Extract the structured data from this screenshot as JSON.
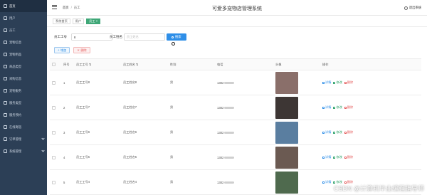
{
  "app": {
    "title": "可爱多宠物店管理系统"
  },
  "header": {
    "breadcrumb": [
      "首页",
      "/",
      "员工"
    ],
    "logout": "退出系统"
  },
  "sidebar": {
    "items": [
      {
        "label": "首页",
        "active": true,
        "caret": false
      },
      {
        "label": "用户",
        "active": false,
        "caret": false
      },
      {
        "label": "员工",
        "active": false,
        "caret": false
      },
      {
        "label": "宠物信息",
        "active": false,
        "caret": false
      },
      {
        "label": "宠物用品",
        "active": false,
        "caret": false
      },
      {
        "label": "商品类型",
        "active": false,
        "caret": false
      },
      {
        "label": "采购信息",
        "active": false,
        "caret": false
      },
      {
        "label": "宠物服务",
        "active": false,
        "caret": false
      },
      {
        "label": "服务类型",
        "active": false,
        "caret": false
      },
      {
        "label": "服务预约",
        "active": false,
        "caret": false
      },
      {
        "label": "在线寄宿",
        "active": false,
        "caret": false
      },
      {
        "label": "订单管理",
        "active": false,
        "caret": true
      },
      {
        "label": "系统管理",
        "active": false,
        "caret": true
      }
    ]
  },
  "tabs": [
    "系统首页",
    "用户",
    "员工 ×"
  ],
  "search": {
    "id_label": "员工工号",
    "id_value": "8",
    "name_label": "员工姓名",
    "name_placeholder": "员工姓名",
    "button": "搜索"
  },
  "actions": {
    "add": "增加",
    "delete": "删除"
  },
  "table": {
    "headers": [
      "序号",
      "员工工号 ⇅",
      "员工姓名 ⇅",
      "性别",
      "电话",
      "头像",
      "操作"
    ],
    "rows": [
      {
        "idx": "1",
        "id": "员工工号8",
        "name": "员工姓名8",
        "sex": "男",
        "phone": "1382",
        "avatar_color": "#8a6f6a"
      },
      {
        "idx": "2",
        "id": "员工工号7",
        "name": "员工姓名7",
        "sex": "男",
        "phone": "1382",
        "avatar_color": "#3d3634"
      },
      {
        "idx": "3",
        "id": "员工工号6",
        "name": "员工姓名6",
        "sex": "男",
        "phone": "1382",
        "avatar_color": "#5a7ea0"
      },
      {
        "idx": "4",
        "id": "员工工号5",
        "name": "员工姓名5",
        "sex": "男",
        "phone": "1382",
        "avatar_color": "#6b5a52"
      },
      {
        "idx": "5",
        "id": "员工工号4",
        "name": "员工姓名4",
        "sex": "男",
        "phone": "1382",
        "avatar_color": "#4f6a4e"
      }
    ],
    "ops": {
      "detail": "详情",
      "edit": "修改",
      "remove": "删除"
    }
  },
  "watermark": "CSDN @计算机毕业编程指导师",
  "colors": {
    "sidebar": "#2c3f56",
    "accent": "#2f8fe8",
    "tab_active": "#3fa777",
    "danger": "#e55b5b"
  }
}
